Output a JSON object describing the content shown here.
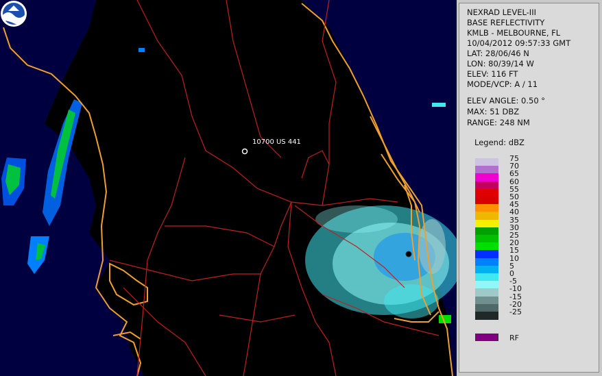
{
  "map": {
    "place_label": "10700 US 441",
    "logo_text": "NOAA"
  },
  "panel": {
    "lines": [
      "NEXRAD LEVEL-III",
      "BASE REFLECTIVITY",
      "KMLB - MELBOURNE, FL",
      "10/04/2012 09:57:33 GMT",
      "LAT: 28/06/46 N",
      "LON: 80/39/14 W",
      "ELEV: 116 FT",
      "MODE/VCP: A / 11"
    ],
    "lines2": [
      "ELEV ANGLE: 0.50 °",
      "MAX: 51 DBZ",
      "RANGE: 248 NM"
    ],
    "legend_title": "Legend: dBZ",
    "legend": [
      {
        "label": "75",
        "color": "#ccc4e0"
      },
      {
        "label": "70",
        "color": "#b36fd0"
      },
      {
        "label": "65",
        "color": "#f000d0"
      },
      {
        "label": "60",
        "color": "#c40060"
      },
      {
        "label": "55",
        "color": "#e00000"
      },
      {
        "label": "50",
        "color": "#d80000"
      },
      {
        "label": "45",
        "color": "#ff9000"
      },
      {
        "label": "40",
        "color": "#eeb800"
      },
      {
        "label": "35",
        "color": "#f4f000"
      },
      {
        "label": "30",
        "color": "#00a000"
      },
      {
        "label": "25",
        "color": "#00c000"
      },
      {
        "label": "20",
        "color": "#00e000"
      },
      {
        "label": "15",
        "color": "#0030ff"
      },
      {
        "label": "10",
        "color": "#0080ff"
      },
      {
        "label": "5",
        "color": "#00b0f0"
      },
      {
        "label": "0",
        "color": "#40e8f0"
      },
      {
        "label": "-5",
        "color": "#90f8f8"
      },
      {
        "label": "-10",
        "color": "#a0c8c8"
      },
      {
        "label": "-15",
        "color": "#709090"
      },
      {
        "label": "-20",
        "color": "#506868"
      },
      {
        "label": "-25",
        "color": "#202828"
      }
    ],
    "rf": {
      "label": "RF",
      "color": "#800080"
    }
  },
  "colors": {
    "coast": "#f0a030",
    "roads": "#c02020",
    "marine": "#000040"
  }
}
